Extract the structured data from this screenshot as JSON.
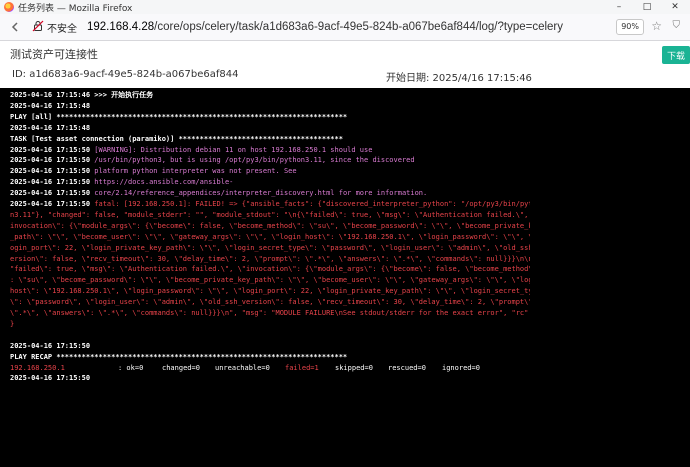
{
  "window": {
    "title": "任务列表 — Mozilla Firefox",
    "controls": [
      "–",
      "□",
      "✕"
    ]
  },
  "urlbar": {
    "security_label": "不安全",
    "url_host": "192.168.4.28",
    "url_path": "/core/ops/celery/task/a1d683a6-9acf-49e5-824b-a067be6af844/log/?type=celery",
    "zoom": "90%"
  },
  "page": {
    "title": "测试资产可连接性",
    "sync_label": "下载",
    "id_label": "ID: a1d683a6-9acf-49e5-824b-a067be6af844",
    "start_label": "开始日期: 2025/4/16 17:15:46"
  },
  "terminal": {
    "lines": [
      {
        "ts": "2025-04-16 17:15:46",
        "text": " >>> 开始执行任务",
        "cls": "wbold"
      },
      {
        "ts": "2025-04-16 17:15:48",
        "text": "",
        "cls": ""
      },
      {
        "ts": "",
        "text": "PLAY [all] *********************************************************************",
        "cls": "wbold"
      },
      {
        "ts": "2025-04-16 17:15:48",
        "text": "",
        "cls": ""
      },
      {
        "ts": "",
        "text": "TASK [Test asset connection (paramiko)] ***************************************",
        "cls": "wbold"
      },
      {
        "ts": "2025-04-16 17:15:50",
        "text": " [WARNING]: Distribution debian 11 on host 192.168.250.1 should use",
        "cls": "pink"
      },
      {
        "ts": "2025-04-16 17:15:50",
        "text": " /usr/bin/python3, but is using /opt/py3/bin/python3.11, since the discovered",
        "cls": "pink"
      },
      {
        "ts": "2025-04-16 17:15:50",
        "text": " platform python interpreter was not present. See",
        "cls": "pink"
      },
      {
        "ts": "2025-04-16 17:15:50",
        "text": " https://docs.ansible.com/ansible-",
        "cls": "pink"
      },
      {
        "ts": "2025-04-16 17:15:50",
        "text": " core/2.14/reference_appendices/interpreter_discovery.html for more information.",
        "cls": "pink"
      },
      {
        "ts": "2025-04-16 17:15:50",
        "text": " fatal: [192.168.250.1]: FAILED! => {\"ansible_facts\": {\"discovered_interpreter_python\": \"/opt/py3/bin/pytho",
        "cls": "red"
      },
      {
        "ts": "",
        "text": "n3.11\"}, \"changed\": false, \"module_stderr\": \"\", \"module_stdout\": \"\\n{\\\"failed\\\": true, \\\"msg\\\": \\\"Authentication failed.\\\", \\\"",
        "cls": "red"
      },
      {
        "ts": "",
        "text": "invocation\\\": {\\\"module_args\\\": {\\\"become\\\": false, \\\"become_method\\\": \\\"su\\\", \\\"become_password\\\": \\\"\\\", \\\"become_private_key",
        "cls": "red"
      },
      {
        "ts": "",
        "text": "_path\\\": \\\"\\\", \\\"become_user\\\": \\\"\\\", \\\"gateway_args\\\": \\\"\\\", \\\"login_host\\\": \\\"192.168.250.1\\\", \\\"login_password\\\": \\\"\\\", \\\"l",
        "cls": "red"
      },
      {
        "ts": "",
        "text": "ogin_port\\\": 22, \\\"login_private_key_path\\\": \\\"\\\", \\\"login_secret_type\\\": \\\"password\\\", \\\"login_user\\\": \\\"admin\\\", \\\"old_ssh_v",
        "cls": "red"
      },
      {
        "ts": "",
        "text": "ersion\\\": false, \\\"recv_timeout\\\": 30, \\\"delay_time\\\": 2, \\\"prompt\\\": \\\".*\\\", \\\"answers\\\": \\\".*\\\", \\\"commands\\\": null}}}\\n\\n{\\",
        "cls": "red"
      },
      {
        "ts": "",
        "text": "\"failed\\\": true, \\\"msg\\\": \\\"Authentication failed.\\\", \\\"invocation\\\": {\\\"module_args\\\": {\\\"become\\\": false, \\\"become_method\\\"",
        "cls": "red"
      },
      {
        "ts": "",
        "text": ": \\\"su\\\", \\\"become_password\\\": \\\"\\\", \\\"become_private_key_path\\\": \\\"\\\", \\\"become_user\\\": \\\"\\\", \\\"gateway_args\\\": \\\"\\\", \\\"login_",
        "cls": "red"
      },
      {
        "ts": "",
        "text": "host\\\": \\\"192.168.250.1\\\", \\\"login_password\\\": \\\"\\\", \\\"login_port\\\": 22, \\\"login_private_key_path\\\": \\\"\\\", \\\"login_secret_type",
        "cls": "red"
      },
      {
        "ts": "",
        "text": "\\\": \\\"password\\\", \\\"login_user\\\": \\\"admin\\\", \\\"old_ssh_version\\\": false, \\\"recv_timeout\\\": 30, \\\"delay_time\\\": 2, \\\"prompt\\\":",
        "cls": "red"
      },
      {
        "ts": "",
        "text": "\\\".*\\\", \\\"answers\\\": \\\".*\\\", \\\"commands\\\": null}}}\\n\", \"msg\": \"MODULE FAILURE\\nSee stdout/stderr for the exact error\", \"rc\": 1",
        "cls": "red"
      },
      {
        "ts": "",
        "text": "}",
        "cls": "red"
      },
      {
        "ts": "",
        "text": "",
        "cls": ""
      },
      {
        "ts": "2025-04-16 17:15:50",
        "text": "",
        "cls": ""
      },
      {
        "ts": "",
        "text": "PLAY RECAP *********************************************************************",
        "cls": "wbold"
      },
      {
        "ts": "",
        "text": "",
        "cls": ""
      },
      {
        "ts": "2025-04-16 17:15:50",
        "text": "",
        "cls": ""
      }
    ],
    "recap": {
      "host": "192.168.250.1",
      "ok": ": ok=0",
      "changed": "changed=0",
      "unreachable": "unreachable=0",
      "failed": "failed=1",
      "skipped": "skipped=0",
      "rescued": "rescued=0",
      "ignored": "ignored=0"
    }
  }
}
